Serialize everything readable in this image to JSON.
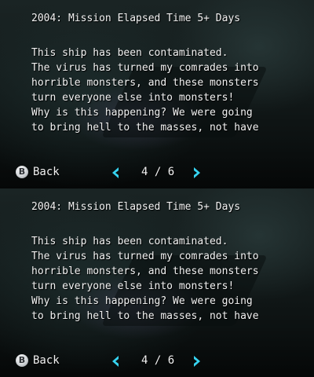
{
  "screens": [
    {
      "heading": "2004: Mission Elapsed Time 5+ Days",
      "lines": [
        "This ship has been contaminated.",
        "The virus has turned my comrades into",
        "horrible monsters, and these monsters",
        "turn everyone else into monsters!",
        "Why is this happening? We were going",
        "to bring hell to the masses, not have"
      ],
      "back": {
        "button_glyph": "B",
        "label": "Back"
      },
      "pager": {
        "current": "4",
        "separator": "/",
        "total": "6",
        "display": "4 / 6"
      }
    },
    {
      "heading": "2004: Mission Elapsed Time 5+ Days",
      "lines": [
        "This ship has been contaminated.",
        "The virus has turned my comrades into",
        "horrible monsters, and these monsters",
        "turn everyone else into monsters!",
        "Why is this happening? We were going",
        "to bring hell to the masses, not have"
      ],
      "back": {
        "button_glyph": "B",
        "label": "Back"
      },
      "pager": {
        "current": "4",
        "separator": "/",
        "total": "6",
        "display": "4 / 6"
      }
    }
  ],
  "colors": {
    "text": "#f2f2f2",
    "arrow": "#36d3f0",
    "background": "#141c1c"
  },
  "icons": {
    "back_button": "b-button-icon",
    "prev": "chevron-left-icon",
    "next": "chevron-right-icon"
  }
}
